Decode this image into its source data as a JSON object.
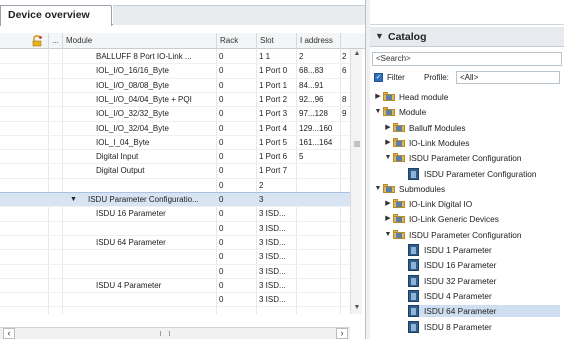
{
  "device_overview": {
    "tab_label": "Device overview",
    "columns": [
      "...",
      "Module",
      "Rack",
      "Slot",
      "I address"
    ],
    "rows": [
      {
        "module": "BALLUFF 8 Port IO-Link ...",
        "rack": "0",
        "slot": "1 1",
        "iaddr": "2",
        "extra": "2",
        "selected": false
      },
      {
        "module": "IOL_I/O_16/16_Byte",
        "rack": "0",
        "slot": "1 Port 0",
        "iaddr": "68...83",
        "extra": "6",
        "selected": false
      },
      {
        "module": "IOL_I/O_08/08_Byte",
        "rack": "0",
        "slot": "1 Port 1",
        "iaddr": "84...91",
        "extra": "",
        "selected": false
      },
      {
        "module": "IOL_I/O_04/04_Byte + PQI",
        "rack": "0",
        "slot": "1 Port 2",
        "iaddr": "92...96",
        "extra": "8",
        "selected": false
      },
      {
        "module": "IOL_I/O_32/32_Byte",
        "rack": "0",
        "slot": "1 Port 3",
        "iaddr": "97...128",
        "extra": "9",
        "selected": false
      },
      {
        "module": "IOL_I/O_32/04_Byte",
        "rack": "0",
        "slot": "1 Port 4",
        "iaddr": "129...160",
        "extra": "",
        "selected": false
      },
      {
        "module": "IOL_I_04_Byte",
        "rack": "0",
        "slot": "1 Port 5",
        "iaddr": "161...164",
        "extra": "",
        "selected": false
      },
      {
        "module": "Digital Input",
        "rack": "0",
        "slot": "1 Port 6",
        "iaddr": "5",
        "extra": "",
        "selected": false
      },
      {
        "module": "Digital Output",
        "rack": "0",
        "slot": "1 Port 7",
        "iaddr": "",
        "extra": "",
        "selected": false
      },
      {
        "module": "",
        "rack": "0",
        "slot": "2",
        "iaddr": "",
        "extra": "",
        "selected": false
      },
      {
        "module": "ISDU Parameter Configuratio...",
        "rack": "0",
        "slot": "3",
        "iaddr": "",
        "extra": "",
        "selected": true,
        "expanded": true
      },
      {
        "module": "ISDU 16 Parameter",
        "rack": "0",
        "slot": "3 ISD...",
        "iaddr": "",
        "extra": "",
        "selected": false
      },
      {
        "module": "",
        "rack": "0",
        "slot": "3 ISD...",
        "iaddr": "",
        "extra": "",
        "selected": false
      },
      {
        "module": "ISDU 64 Parameter",
        "rack": "0",
        "slot": "3 ISD...",
        "iaddr": "",
        "extra": "",
        "selected": false
      },
      {
        "module": "",
        "rack": "0",
        "slot": "3 ISD...",
        "iaddr": "",
        "extra": "",
        "selected": false
      },
      {
        "module": "",
        "rack": "0",
        "slot": "3 ISD...",
        "iaddr": "",
        "extra": "",
        "selected": false
      },
      {
        "module": "ISDU 4 Parameter",
        "rack": "0",
        "slot": "3 ISD...",
        "iaddr": "",
        "extra": "",
        "selected": false
      },
      {
        "module": "",
        "rack": "0",
        "slot": "3 ISD...",
        "iaddr": "",
        "extra": "",
        "selected": false
      }
    ]
  },
  "catalog": {
    "title": "Catalog",
    "search_placeholder": "<Search>",
    "filter_label": "Filter",
    "profile_label": "Profile:",
    "profile_value": "<All>",
    "tree": [
      {
        "label": "Head module",
        "level": 0,
        "state": "collapsed",
        "kind": "folder"
      },
      {
        "label": "Module",
        "level": 0,
        "state": "expanded",
        "kind": "folder"
      },
      {
        "label": "Balluff Modules",
        "level": 1,
        "state": "collapsed",
        "kind": "folder"
      },
      {
        "label": "IO-Link Modules",
        "level": 1,
        "state": "collapsed",
        "kind": "folder"
      },
      {
        "label": "ISDU Parameter Configuration",
        "level": 1,
        "state": "expanded",
        "kind": "folder"
      },
      {
        "label": "ISDU Parameter Configuration",
        "level": 2,
        "state": "leaf",
        "kind": "device"
      },
      {
        "label": "Submodules",
        "level": 0,
        "state": "expanded",
        "kind": "folder"
      },
      {
        "label": "IO-Link Digital IO",
        "level": 1,
        "state": "collapsed",
        "kind": "folder"
      },
      {
        "label": "IO-Link Generic Devices",
        "level": 1,
        "state": "collapsed",
        "kind": "folder"
      },
      {
        "label": "ISDU Parameter Configuration",
        "level": 1,
        "state": "expanded",
        "kind": "folder"
      },
      {
        "label": "ISDU 1 Parameter",
        "level": 2,
        "state": "leaf",
        "kind": "device"
      },
      {
        "label": "ISDU 16 Parameter",
        "level": 2,
        "state": "leaf",
        "kind": "device"
      },
      {
        "label": "ISDU 32 Parameter",
        "level": 2,
        "state": "leaf",
        "kind": "device"
      },
      {
        "label": "ISDU 4 Parameter",
        "level": 2,
        "state": "leaf",
        "kind": "device"
      },
      {
        "label": "ISDU 64 Parameter",
        "level": 2,
        "state": "leaf",
        "kind": "device",
        "highlighted": true
      },
      {
        "label": "ISDU 8 Parameter",
        "level": 2,
        "state": "leaf",
        "kind": "device"
      }
    ]
  }
}
